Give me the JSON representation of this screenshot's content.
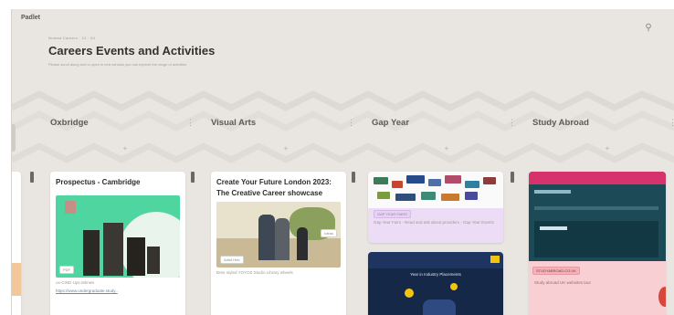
{
  "app": {
    "name": "Padlet"
  },
  "header": {
    "breadcrumb": "Nomad Careers · 12 · 64",
    "title": "Careers Events and Activities",
    "subtitle": "Please scroll along and to open in new window you can explore the range of activities"
  },
  "columns": [
    {
      "title": "Oxbridge",
      "cards": [
        {
          "title": "Prospectus - Cambridge",
          "caption": "ox-CIND-Upt-Jeknws",
          "link": "https://www.undergraduate.study..",
          "badge": "PDF"
        }
      ]
    },
    {
      "title": "Visual Arts",
      "cards": [
        {
          "title": "Create Your Future London 2023: The Creative Career showcase",
          "caption": "Bree styled YOYOZ Studio Library wheels",
          "badge_left": "Artist Hub",
          "badge_right": "Ideas"
        }
      ]
    },
    {
      "title": "Gap Year",
      "cards": [
        {
          "caption": "Gap Year Fairs - Read and ask about providers - Gap Year Events",
          "tag": "GAP YEAR FAIRS"
        },
        {
          "caption": "Year in Industry Placements"
        }
      ]
    },
    {
      "title": "Study Abroad",
      "cards": [
        {
          "caption": "Study abroad UK websites tour",
          "tag": "STUDYABROAD.CO.UK"
        }
      ]
    }
  ],
  "colors": {
    "background": "#e9e6e2",
    "card": "#ffffff",
    "gap_card": "#eddcf6",
    "brochure_green": "#4fd6a0",
    "study_pink": "#f8cfd3"
  }
}
